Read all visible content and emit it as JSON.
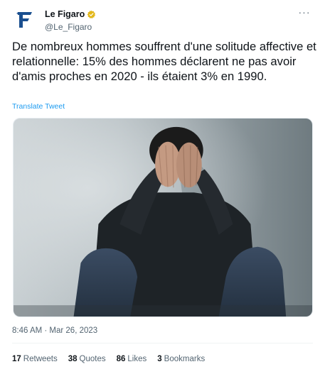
{
  "account": {
    "display_name": "Le Figaro",
    "handle": "@Le_Figaro",
    "verified_color": "#e2b719",
    "logo_color": "#1a4f8f",
    "logo_icon": "figaro-f-logo"
  },
  "tweet": {
    "text": "De nombreux hommes souffrent d'une solitude affective et relationnelle: 15% des hommes déclarent ne pas avoir d'amis proches en 2020 - ils étaient 3% en 1990.",
    "translate_label": "Translate Tweet",
    "image_alt": "Man sitting against a wall with his face in his hands",
    "timestamp": "8:46 AM · Mar 26, 2023"
  },
  "more_icon": "ellipsis-icon",
  "stats": {
    "retweets_count": "17",
    "retweets_label": "Retweets",
    "quotes_count": "38",
    "quotes_label": "Quotes",
    "likes_count": "86",
    "likes_label": "Likes",
    "bookmarks_count": "3",
    "bookmarks_label": "Bookmarks"
  }
}
